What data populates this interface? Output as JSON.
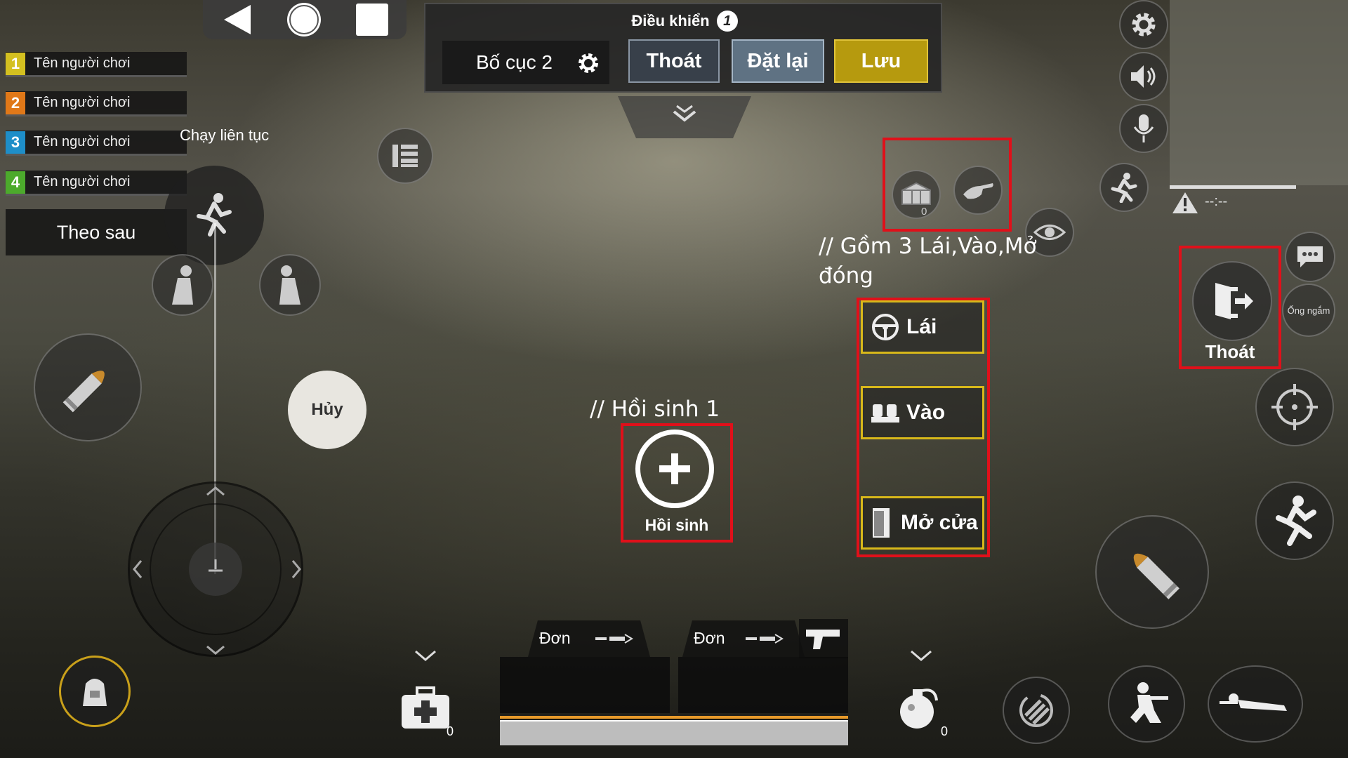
{
  "top_panel": {
    "title": "Điều khiển",
    "info_badge": "1",
    "layout_label": "Bố cục 2",
    "exit_label": "Thoát",
    "reset_label": "Đặt lại",
    "save_label": "Lưu",
    "colors": {
      "panel": "#2b2b2b",
      "exit_bg": "#38404a",
      "reset_bg": "#5f7283",
      "save_bg": "#b69a0e"
    }
  },
  "nav_buttons": [
    "back-icon",
    "home-icon",
    "recents-icon"
  ],
  "players": [
    {
      "num": "1",
      "name": "Tên người chơi",
      "color": "#d4c020"
    },
    {
      "num": "2",
      "name": "Tên người chơi",
      "color": "#e07818"
    },
    {
      "num": "3",
      "name": "Tên người chơi",
      "color": "#1e8ec8"
    },
    {
      "num": "4",
      "name": "Tên người chơi",
      "color": "#4caa2c"
    }
  ],
  "follow_label": "Theo sau",
  "sprint_label": "Chạy liên tục",
  "cancel_label": "Hủy",
  "revive": {
    "label": "Hồi sinh",
    "note": "// Hồi sinh 1"
  },
  "vehicle": {
    "note_line1": "// Gồm 3 Lái,Vào,Mở",
    "note_line2": "đóng",
    "drive_label": "Lái",
    "enter_label": "Vào",
    "door_label": "Mở cửa"
  },
  "pickup_count": "0",
  "exit_button_label": "Thoát",
  "scope_label": "Ống ngắm",
  "minimap_text": "--:--",
  "weapons": [
    {
      "mode": "Đơn"
    },
    {
      "mode": "Đơn"
    }
  ],
  "medkit_count": "0",
  "grenade_count": "0",
  "icons": {
    "settings": "gear-icon",
    "sound": "speaker-icon",
    "mic": "microphone-icon",
    "sprint": "runner-icon",
    "eye": "eye-icon",
    "chat": "chat-icon",
    "aim": "crosshair-icon",
    "jump": "jump-icon",
    "fire": "bullet-icon",
    "reload": "reload-icon",
    "crouch": "crouch-icon",
    "prone": "prone-icon",
    "backpack": "backpack-icon",
    "medkit": "medkit-icon",
    "grenade": "grenade-icon"
  }
}
